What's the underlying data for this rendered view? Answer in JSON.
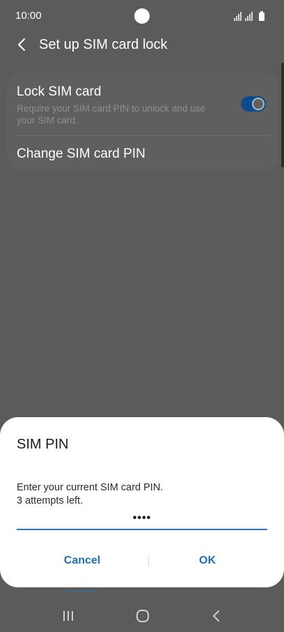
{
  "status_bar": {
    "time": "10:00"
  },
  "header": {
    "title": "Set up SIM card lock"
  },
  "settings": {
    "lock_sim": {
      "title": "Lock SIM card",
      "description": "Require your SIM card PIN to unlock and use your SIM card.",
      "enabled": true
    },
    "change_pin": {
      "label": "Change SIM card PIN"
    }
  },
  "dialog": {
    "title": "SIM PIN",
    "message_line1": "Enter your current SIM card PIN.",
    "message_line2": "3 attempts left.",
    "pin_value": "••••",
    "cancel_label": "Cancel",
    "ok_label": "OK"
  },
  "colors": {
    "accent": "#1f6fbf",
    "toggle_on": "#0c4a8a",
    "scrim": "#5b5b5b",
    "dialog_bg": "#ffffff"
  },
  "icons": {
    "back": "back-arrow-icon",
    "signal": "signal-icon",
    "battery": "battery-icon",
    "recent_apps": "recent-apps-icon",
    "home": "home-icon",
    "nav_back": "nav-back-icon"
  }
}
